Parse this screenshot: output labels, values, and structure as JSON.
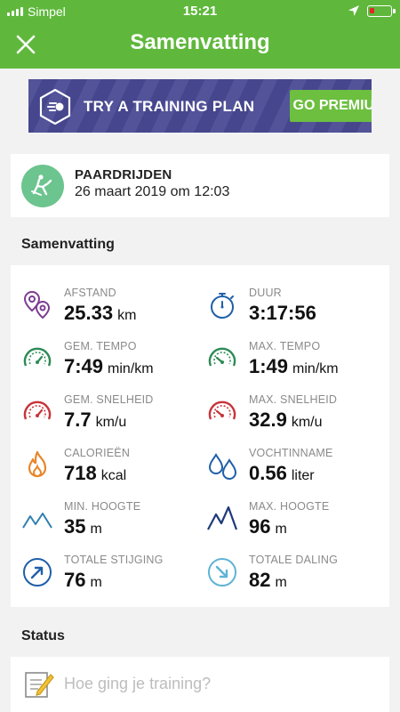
{
  "status_bar": {
    "carrier": "Simpel",
    "time": "15:21"
  },
  "header": {
    "title": "Samenvatting",
    "close_icon": "close-icon"
  },
  "promo": {
    "text": "TRY A TRAINING PLAN",
    "button": "GO PREMIUM"
  },
  "activity": {
    "name": "PAARDRIJDEN",
    "datetime": "26 maart 2019 om 12:03",
    "icon": "horse-riding-icon"
  },
  "summary": {
    "title": "Samenvatting",
    "stats": [
      {
        "label": "AFSTAND",
        "value": "25.33",
        "unit": "km",
        "icon": "distance-pins-icon"
      },
      {
        "label": "DUUR",
        "value": "3:17:56",
        "unit": "",
        "icon": "stopwatch-icon"
      },
      {
        "label": "GEM. TEMPO",
        "value": "7:49",
        "unit": "min/km",
        "icon": "avg-pace-gauge-icon"
      },
      {
        "label": "MAX. TEMPO",
        "value": "1:49",
        "unit": "min/km",
        "icon": "max-pace-gauge-icon"
      },
      {
        "label": "GEM. SNELHEID",
        "value": "7.7",
        "unit": "km/u",
        "icon": "avg-speed-gauge-icon"
      },
      {
        "label": "MAX. SNELHEID",
        "value": "32.9",
        "unit": "km/u",
        "icon": "max-speed-gauge-icon"
      },
      {
        "label": "CALORIEËN",
        "value": "718",
        "unit": "kcal",
        "icon": "flame-icon"
      },
      {
        "label": "VOCHTINNAME",
        "value": "0.56",
        "unit": "liter",
        "icon": "water-drops-icon"
      },
      {
        "label": "MIN. HOOGTE",
        "value": "35",
        "unit": "m",
        "icon": "mountain-low-icon"
      },
      {
        "label": "MAX. HOOGTE",
        "value": "96",
        "unit": "m",
        "icon": "mountain-high-icon"
      },
      {
        "label": "TOTALE STIJGING",
        "value": "76",
        "unit": "m",
        "icon": "ascent-arrow-icon"
      },
      {
        "label": "TOTALE DALING",
        "value": "82",
        "unit": "m",
        "icon": "descent-arrow-icon"
      }
    ]
  },
  "status": {
    "title": "Status",
    "placeholder": "Hoe ging je training?",
    "icon": "notepad-pencil-icon"
  },
  "colors": {
    "header_green": "#5fb83c",
    "promo_purple": "#4a4a95",
    "premium_green": "#6cbf3f",
    "avatar_green": "#6cc48f"
  }
}
